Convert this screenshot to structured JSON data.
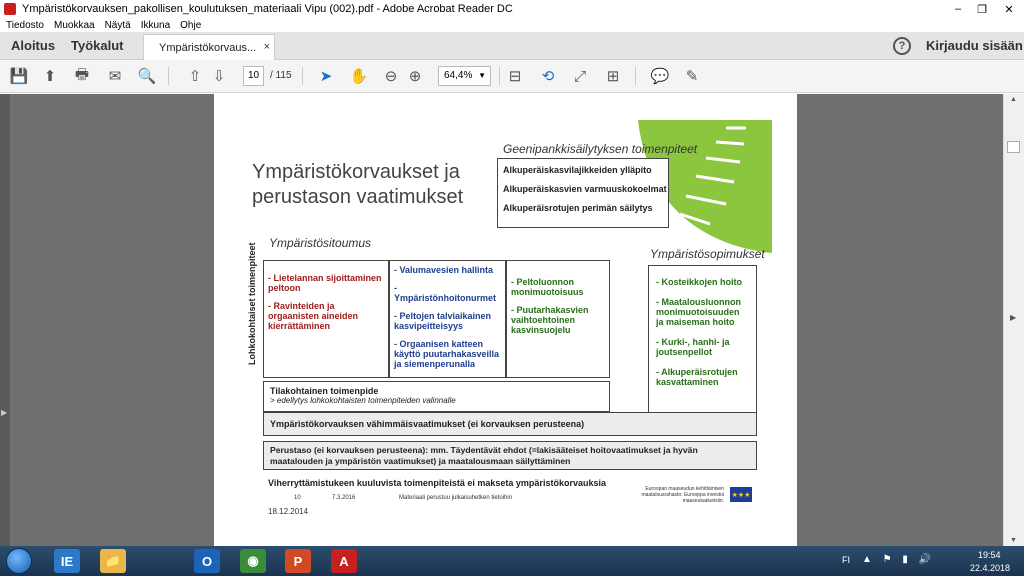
{
  "window": {
    "title": "Ympäristökorvauksen_pakollisen_koulutuksen_materiaali Vipu (002).pdf - Adobe Acrobat Reader DC",
    "minimize": "–",
    "restore": "❐",
    "close": "✕"
  },
  "menu": [
    "Tiedosto",
    "Muokkaa",
    "Näytä",
    "Ikkuna",
    "Ohje"
  ],
  "tabs": {
    "home": "Aloitus",
    "tools": "Työkalut",
    "document": "Ympäristökorvaus...",
    "close": "×"
  },
  "header": {
    "help": "?",
    "signin": "Kirjaudu sisään"
  },
  "toolbar": {
    "page_current": "10",
    "page_total": "/ 115",
    "zoom": "64,4%",
    "zoom_caret": "▼",
    "icons": {
      "save": "💾",
      "upload": "⬆",
      "print": "🖶",
      "email": "✉",
      "search": "🔍",
      "prev": "⇧",
      "next": "⇩",
      "select": "➤",
      "hand": "✋",
      "zoom_out": "⊖",
      "zoom_in": "⊕",
      "fit": "⊟",
      "rotate": "⟲",
      "fullscreen": "⤢",
      "scroll": "⊞",
      "comment": "💬",
      "sign": "✎"
    }
  },
  "slide": {
    "title": "Ympäristökorvaukset ja perustason vaatimukset",
    "gene_title": "Geenipankkisäilytyksen toimenpiteet",
    "gene_items": [
      "Alkuperäiskasvilajikkeiden ylläpito",
      "Alkuperäiskasvien varmuuskokoelmat",
      "Alkuperäisrotujen perimän säilytys"
    ],
    "sitoumus_title": "Ympäristösitoumus",
    "sopimukset_title": "Ympäristösopimukset",
    "vertical_label": "Lohkokohtaiset toimenpiteet",
    "col1": [
      "- Lietelannan sijoittaminen peltoon",
      "- Ravinteiden ja orgaanisten aineiden kierrättäminen"
    ],
    "col2": [
      "- Valumavesien hallinta",
      "- Ympäristönhoitonurmet",
      "- Peltojen talviaikainen kasvipeitteisyys",
      "- Orgaanisen katteen käyttö puutarhakasveilla ja siemenperunalla"
    ],
    "col3": [
      "- Peltoluonnon monimuotoisuus",
      "- Puutarhakasvien vaihtoehtoinen kasvinsuojelu"
    ],
    "col4": [
      "- Kosteikkojen hoito",
      "- Maatalousluonnon monimuotoisuuden ja maiseman hoito",
      "- Kurki-, hanhi- ja joutsenpellot",
      "- Alkuperäisrotujen kasvattaminen"
    ],
    "tila_title": "Tilakohtainen toimenpide",
    "tila_sub": "> edellytys lohkokohtaisten toimenpiteiden valinnalle",
    "vahim": "Ympäristökorvauksen vähimmäisvaatimukset (ei korvauksen perusteena)",
    "perus": "Perustaso (ei korvauksen perusteena): mm. Täydentävät ehdot (=lakisääteiset hoitovaatimukset ja hyvän maatalouden ja ympäristön vaatimukset) ja maatalousmaan säilyttäminen",
    "viher": "Viherryttämistukeen kuuluvista toimenpiteistä ei makseta ympäristökorvauksia",
    "foot_num": "10",
    "foot_date": "7.3.2016",
    "foot_mat": "Materiaali perustuu julkaisuhetken tietoihin",
    "foot_date2": "18.12.2014",
    "eu_text": "Euroopan maaseudun kehittämisen maatalousrahasto: Eurooppa investoi maaseutualueisiin.",
    "eu_flag": "★★★"
  },
  "taskbar": {
    "apps": [
      "IE",
      "📁",
      "O",
      "◉",
      "P",
      "A"
    ],
    "lang": "FI",
    "tray": "▲ ⚑ ▮ 🔊",
    "time": "19:54",
    "date": "22.4.2018"
  },
  "colors": {
    "acrobat_red": "#c8201f",
    "accent_blue": "#1f6fcf",
    "slide_green": "#8cc63f",
    "red_text": "#9c1b1b",
    "blue_text": "#1e3f8f",
    "green_text": "#2a6e1a"
  }
}
